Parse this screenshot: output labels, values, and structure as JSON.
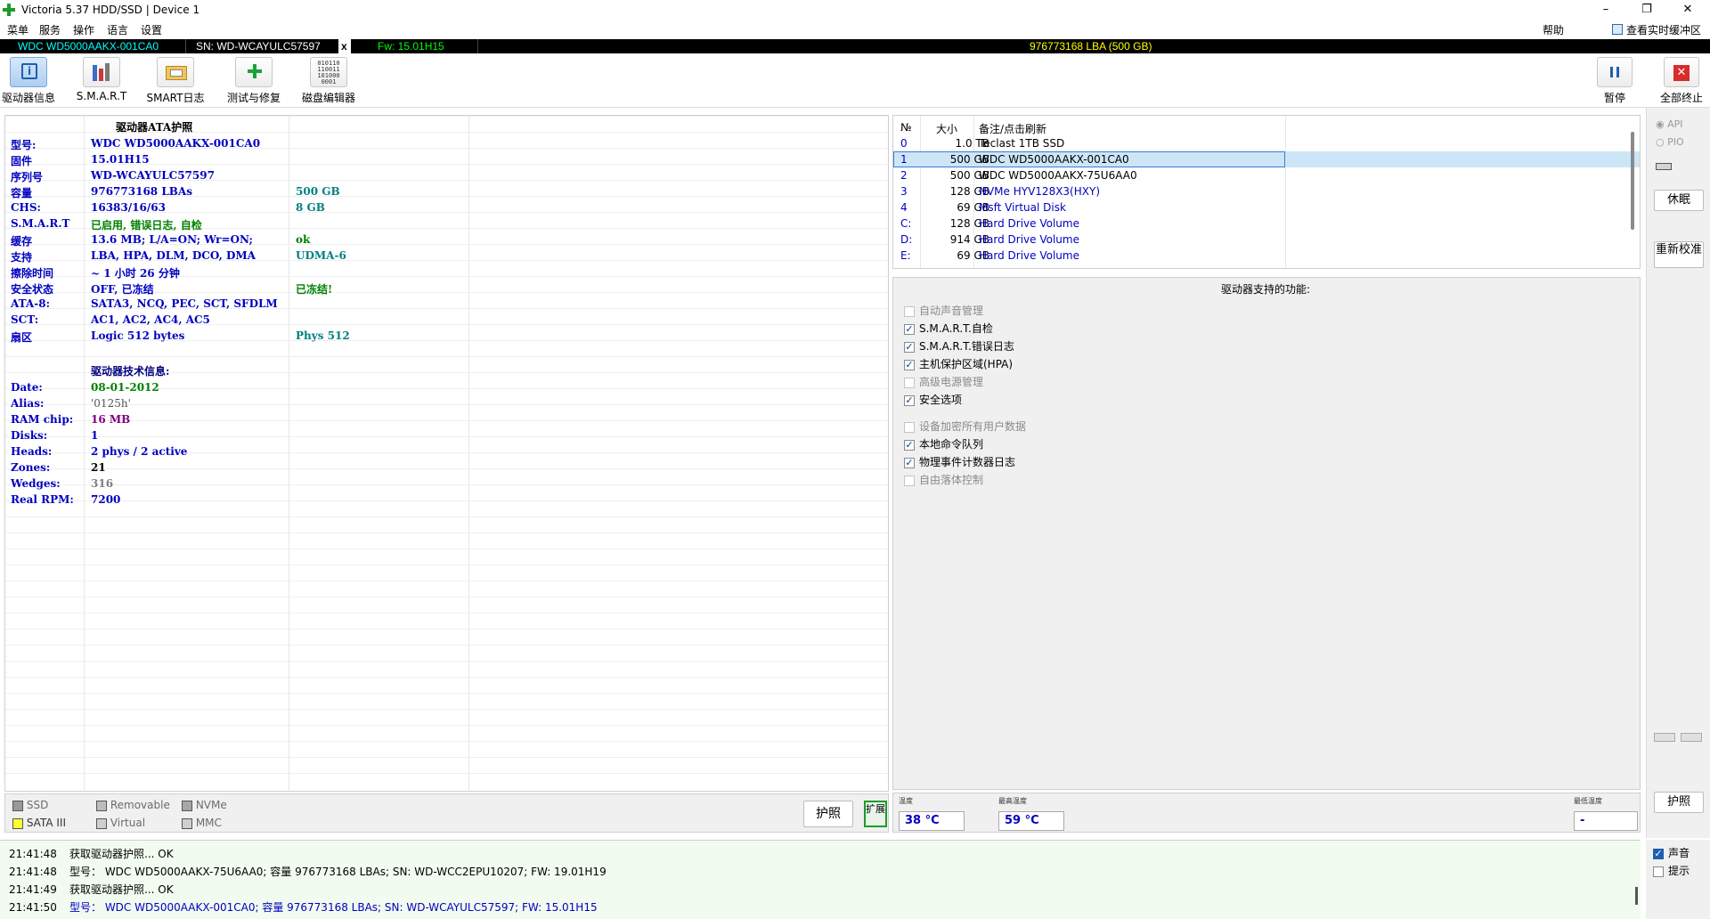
{
  "window": {
    "title": "Victoria 5.37 HDD/SSD | Device 1",
    "minimize": "–",
    "maximize": "❐",
    "close": "✕"
  },
  "menu": {
    "items": [
      "菜单",
      "服务",
      "操作",
      "语言",
      "设置"
    ],
    "help": "帮助",
    "realtime": "查看实时缓冲区"
  },
  "strip": {
    "model": "WDC WD5000AAKX-001CA0",
    "serial": "SN: WD-WCAYULC57597",
    "x": "x",
    "fw": "Fw: 15.01H15",
    "lba": "976773168 LBA (500 GB)",
    "colors": {
      "model": "#00ffff",
      "serial": "#ffffff",
      "fw": "#00ff00",
      "lba": "#ffff00"
    }
  },
  "toolbar": {
    "buttons": [
      "驱动器信息",
      "S.M.A.R.T",
      "SMART日志",
      "测试与修复",
      "磁盘编辑器"
    ],
    "pause": "暂停",
    "stop_all": "全部终止"
  },
  "info": {
    "title": "驱动器ATA护照",
    "rows": [
      {
        "k": "型号:",
        "v": "WDC WD5000AAKX-001CA0",
        "x": ""
      },
      {
        "k": "固件",
        "v": "15.01H15",
        "x": ""
      },
      {
        "k": "序列号",
        "v": "WD-WCAYULC57597",
        "x": ""
      },
      {
        "k": "容量",
        "v": "976773168 LBAs",
        "x": "500 GB"
      },
      {
        "k": "CHS:",
        "v": "16383/16/63",
        "x": "8 GB"
      },
      {
        "k": "S.M.A.R.T",
        "v": "已启用, 错误日志, 自检",
        "x": ""
      },
      {
        "k": "缓存",
        "v": "13.6 MB; L/A=ON; Wr=ON;",
        "x": "ok"
      },
      {
        "k": "支持",
        "v": "LBA, HPA, DLM, DCO, DMA",
        "x": "UDMA-6"
      },
      {
        "k": "擦除时间",
        "v": "~ 1 小时 26 分钟",
        "x": ""
      },
      {
        "k": "安全状态",
        "v": "OFF, 已冻结",
        "x": "已冻结!"
      },
      {
        "k": "ATA-8:",
        "v": "SATA3, NCQ, PEC, SCT, SFDLM",
        "x": ""
      },
      {
        "k": "SCT:",
        "v": "AC1, AC2, AC4, AC5",
        "x": ""
      },
      {
        "k": "扇区",
        "v": "Logic 512 bytes",
        "x": "Phys 512"
      }
    ],
    "tech_title": "驱动器技术信息:",
    "tech": [
      {
        "k": "Date:",
        "v": "08-01-2012"
      },
      {
        "k": "Alias:",
        "v": "'0125h'"
      },
      {
        "k": "RAM chip:",
        "v": "16 MB"
      },
      {
        "k": "Disks:",
        "v": "1"
      },
      {
        "k": "Heads:",
        "v": "2 phys / 2 active"
      },
      {
        "k": "Zones:",
        "v": "21"
      },
      {
        "k": "Wedges:",
        "v": "316"
      },
      {
        "k": "Real RPM:",
        "v": "7200"
      }
    ]
  },
  "legend": {
    "items": [
      "SSD",
      "Removable",
      "NVMe",
      "SATA III",
      "Virtual",
      "MMC"
    ],
    "passport": "护照",
    "expand": "扩展"
  },
  "drives": {
    "headers": [
      "№",
      "大小",
      "备注/点击刷新"
    ],
    "rows": [
      {
        "n": "0",
        "size": "1.0 TB",
        "name": "Teclast 1TB SSD"
      },
      {
        "n": "1",
        "size": "500 GB",
        "name": "WDC WD5000AAKX-001CA0"
      },
      {
        "n": "2",
        "size": "500 GB",
        "name": "WDC WD5000AAKX-75U6AA0"
      },
      {
        "n": "3",
        "size": "128 GB",
        "name": "NVMe     HYV128X3(HXY)"
      },
      {
        "n": "4",
        "size": "69 GB",
        "name": "Msft     Virtual Disk"
      },
      {
        "n": "C:",
        "size": "128 GB",
        "name": "Hard Drive Volume"
      },
      {
        "n": "D:",
        "size": "914 GB",
        "name": "Hard Drive Volume"
      },
      {
        "n": "E:",
        "size": "69 GB",
        "name": "Hard Drive Volume"
      }
    ]
  },
  "features": {
    "title": "驱动器支持的功能:",
    "items": [
      {
        "label": "自动声音管理",
        "checked": false
      },
      {
        "label": "S.M.A.R.T.自检",
        "checked": true
      },
      {
        "label": "S.M.A.R.T.错误日志",
        "checked": true
      },
      {
        "label": "主机保护区域(HPA)",
        "checked": true
      },
      {
        "label": "高级电源管理",
        "checked": false
      },
      {
        "label": "安全选项",
        "checked": true
      },
      {
        "label": "设备加密所有用户数据",
        "checked": false
      },
      {
        "label": "本地命令队列",
        "checked": true
      },
      {
        "label": "物理事件计数器日志",
        "checked": true
      },
      {
        "label": "自由落体控制",
        "checked": false
      }
    ]
  },
  "temps": {
    "temp_label": "温度",
    "temp": "38 °C",
    "max_label": "最高温度",
    "max": "59 °C",
    "min_label": "最低温度",
    "min": "-"
  },
  "sidebar": {
    "api": "API",
    "pio": "PIO",
    "sleep": "休眠",
    "recal": "重新校准",
    "passport": "护照",
    "sound": "声音",
    "hints": "提示"
  },
  "log": [
    {
      "t": "21:41:48",
      "msg": "获取驱动器护照... OK",
      "color": "#000000"
    },
    {
      "t": "21:41:48",
      "msg": "型号： WDC WD5000AAKX-75U6AA0; 容量 976773168 LBAs; SN: WD-WCC2EPU10207; FW: 19.01H19",
      "color": "#000000"
    },
    {
      "t": "21:41:49",
      "msg": "获取驱动器护照... OK",
      "color": "#000000"
    },
    {
      "t": "21:41:50",
      "msg": "型号： WDC WD5000AAKX-001CA0; 容量 976773168 LBAs; SN: WD-WCAYULC57597; FW: 15.01H15",
      "color": "#0000c0"
    }
  ]
}
